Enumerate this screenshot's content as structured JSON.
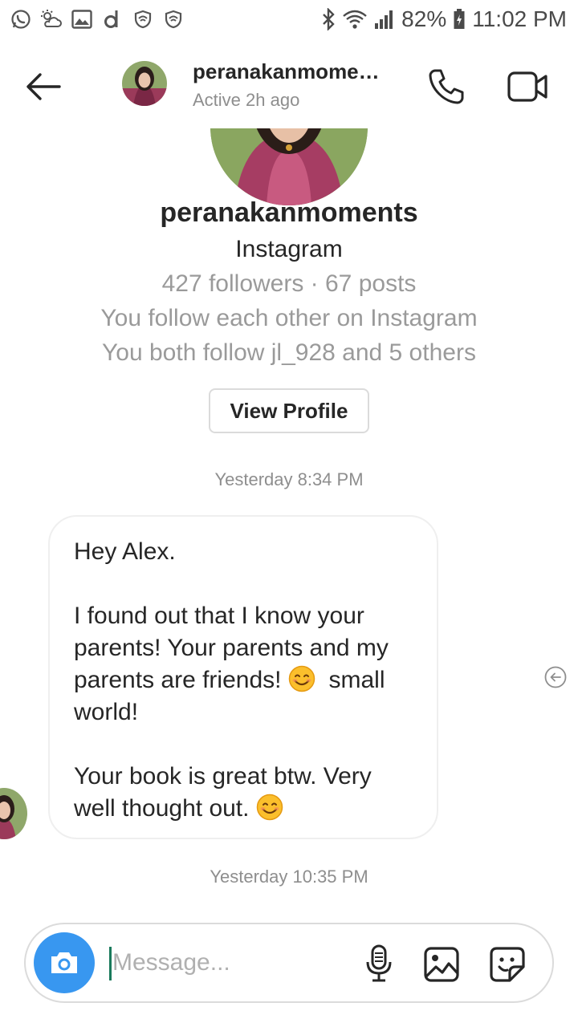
{
  "status_bar": {
    "battery": "82%",
    "time": "11:02 PM"
  },
  "header": {
    "username": "peranakanmome…",
    "activity": "Active 2h ago"
  },
  "profile": {
    "username": "peranakanmoments",
    "platform": "Instagram",
    "stats": "427 followers · 67 posts",
    "follow_status": "You follow each other on Instagram",
    "mutual": "You both follow jl_928 and 5 others",
    "view_profile_label": "View Profile"
  },
  "messages": [
    {
      "timestamp": "Yesterday 8:34 PM",
      "line1": "Hey Alex.",
      "line2a": "I found out that I know your parents! Your parents and my parents are friends!",
      "line2b": "small world!",
      "line3": "Your book is great btw. Very well thought out."
    }
  ],
  "timestamp2": "Yesterday 10:35 PM",
  "composer": {
    "placeholder": "Message..."
  },
  "colors": {
    "accent": "#3897f0",
    "text": "#262626",
    "secondary": "#8e8e8e",
    "border": "#dbdbdb"
  }
}
